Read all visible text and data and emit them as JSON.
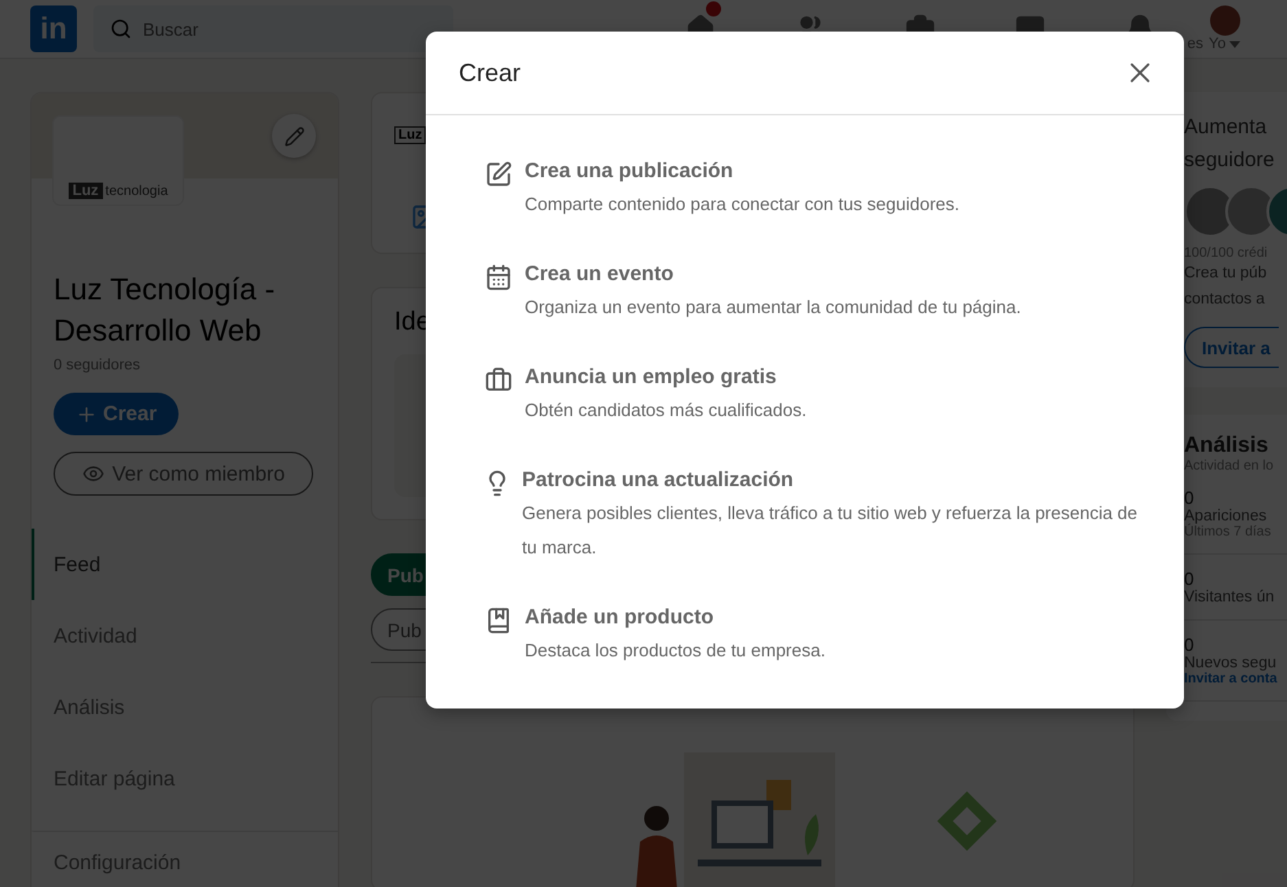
{
  "nav": {
    "logo": "in",
    "search": {
      "placeholder": "Buscar"
    },
    "items": [
      {
        "kind": "home",
        "badge": true
      },
      {
        "kind": "network"
      },
      {
        "kind": "jobs"
      },
      {
        "kind": "messaging"
      },
      {
        "kind": "notifications",
        "label": "es"
      }
    ],
    "me": {
      "label": "Yo"
    }
  },
  "company": {
    "logo": {
      "word_1": "Luz",
      "word_2": "tecnologia"
    },
    "name": "Luz Tecnología - Desarrollo Web",
    "followers": "0 seguidores",
    "create_button": "Crear",
    "view_button": "Ver como miembro",
    "menu": [
      {
        "label": "Feed",
        "selected": true
      },
      {
        "label": "Actividad",
        "selected": false
      },
      {
        "label": "Análisis",
        "selected": false
      },
      {
        "label": "Editar página",
        "selected": false
      },
      {
        "label": "Configuración",
        "selected": false
      }
    ]
  },
  "feed": {
    "post_logo": "Luz",
    "ideas_title": "Ide",
    "chips": [
      {
        "label": "Pub",
        "selected": true
      },
      {
        "label": "Pub",
        "selected": false
      }
    ]
  },
  "right": {
    "promo": {
      "title_lines": [
        "Aumenta",
        "seguidore"
      ],
      "credits": "100/100 crédi",
      "text_lines": [
        "Crea tu púb",
        "contactos a"
      ],
      "button": "Invitar a"
    },
    "analytics": {
      "title": "Análisis",
      "subtitle": "Actividad en lo",
      "stats": [
        {
          "value": "0",
          "label": "Apariciones",
          "note": "Últimos 7 días"
        },
        {
          "value": "0",
          "label": "Visitantes ún"
        },
        {
          "value": "0",
          "label": "Nuevos segu",
          "link": "Invitar a conta"
        }
      ]
    }
  },
  "dialog": {
    "title": "Crear",
    "options": [
      {
        "kind": "post",
        "title": "Crea una publicación",
        "description": "Comparte contenido para conectar con tus seguidores."
      },
      {
        "kind": "event",
        "title": "Crea un evento",
        "description": "Organiza un evento para aumentar la comunidad de tu página."
      },
      {
        "kind": "job",
        "title": "Anuncia un empleo gratis",
        "description": "Obtén candidatos más cualificados."
      },
      {
        "kind": "sponsor",
        "title": "Patrocina una actualización",
        "description": "Genera posibles clientes, lleva tráfico a tu sitio web y refuerza la presencia de tu marca."
      },
      {
        "kind": "product",
        "title": "Añade un producto",
        "description": "Destaca los productos de tu empresa."
      }
    ]
  }
}
